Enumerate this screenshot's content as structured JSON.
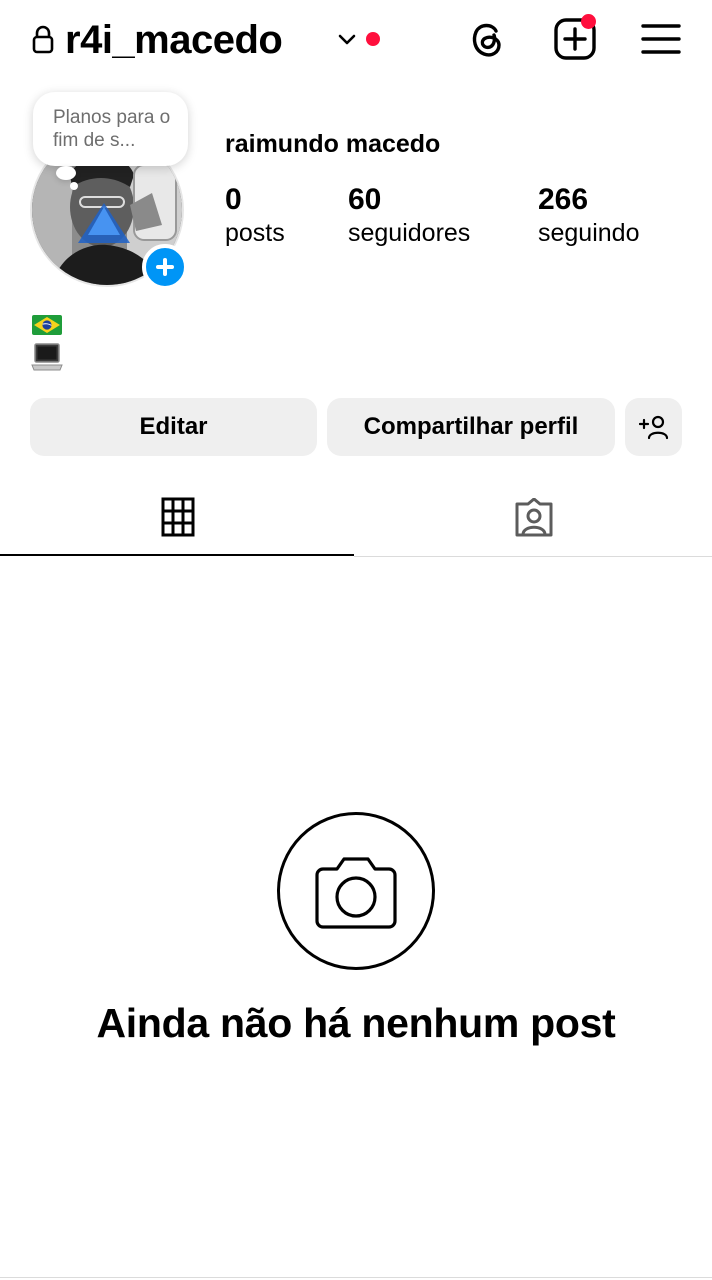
{
  "header": {
    "username": "r4i_macedo",
    "has_live_indicator": true,
    "has_create_notification": true,
    "icons": [
      "lock-icon",
      "chevron-down-icon",
      "threads-icon",
      "create-post-icon",
      "menu-icon"
    ]
  },
  "profile": {
    "note": "Planos para o fim de s...",
    "full_name": "raimundo macedo",
    "bio_emojis": [
      "flag-brazil",
      "laptop"
    ]
  },
  "stats": [
    {
      "value": "0",
      "label": "posts"
    },
    {
      "value": "60",
      "label": "seguidores"
    },
    {
      "value": "266",
      "label": "seguindo"
    }
  ],
  "actions": {
    "edit": "Editar",
    "share": "Compartilhar perfil"
  },
  "tabs": {
    "active": "grid",
    "items": [
      "grid-icon",
      "tagged-icon"
    ]
  },
  "empty_state": {
    "title": "Ainda não há nenhum post",
    "icon": "camera-icon"
  },
  "colors": {
    "accent_blue": "#0095f6",
    "notification_red": "#ff0f3d",
    "button_bg": "#efefef"
  }
}
